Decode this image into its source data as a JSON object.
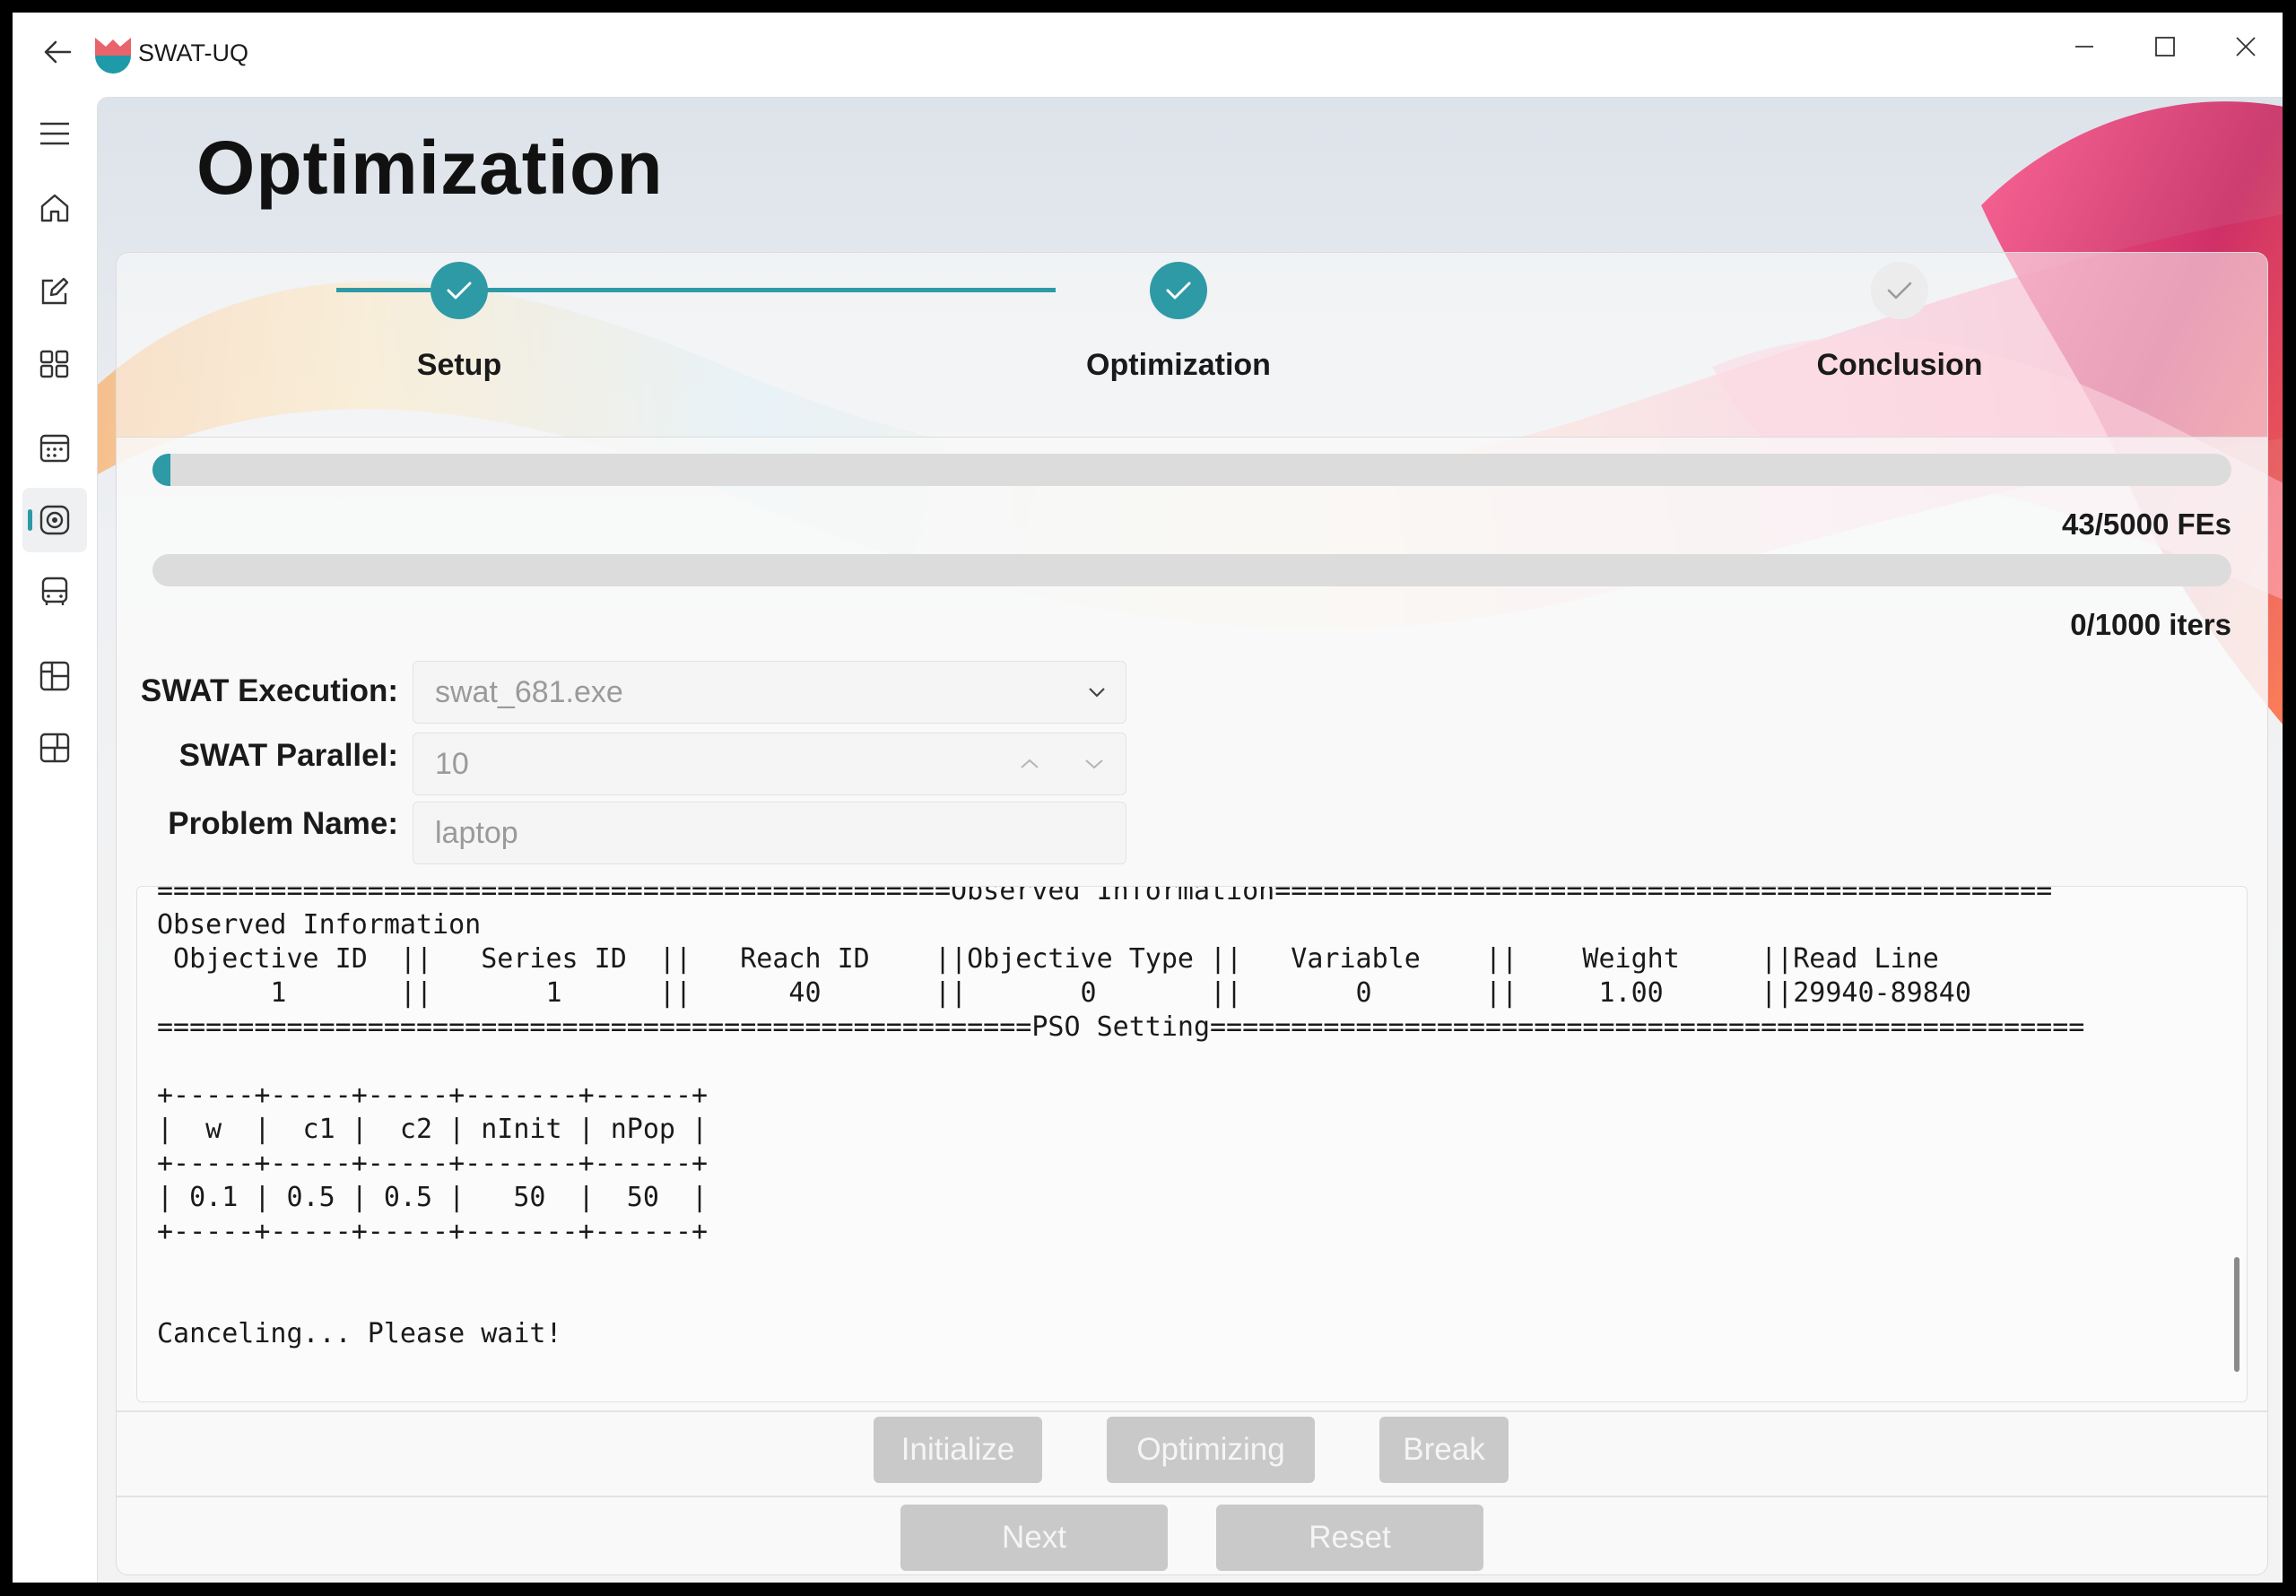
{
  "app": {
    "title": "SWAT-UQ",
    "accent": "#2e9aa6"
  },
  "titlebar_icons": {
    "back": "back-arrow-icon",
    "minimize": "minimize-icon",
    "maximize": "maximize-icon",
    "close": "close-icon"
  },
  "sidebar": {
    "items": [
      {
        "icon": "hamburger-menu-icon"
      },
      {
        "icon": "home-icon"
      },
      {
        "icon": "edit-icon"
      },
      {
        "icon": "apps-icon"
      },
      {
        "icon": "calendar-icon"
      },
      {
        "icon": "target-icon",
        "active": true
      },
      {
        "icon": "bus-icon"
      },
      {
        "icon": "layout-icon"
      },
      {
        "icon": "layout-alt-icon"
      }
    ]
  },
  "page": {
    "title": "Optimization"
  },
  "stepper": {
    "steps": [
      {
        "label": "Setup",
        "state": "done"
      },
      {
        "label": "Optimization",
        "state": "done"
      },
      {
        "label": "Conclusion",
        "state": "pending"
      }
    ]
  },
  "progress": {
    "fes": {
      "text": "43/5000 FEs",
      "fraction": 0.0086
    },
    "iters": {
      "text": "0/1000 iters",
      "fraction": 0.0
    }
  },
  "form": {
    "execution_label": "SWAT Execution:",
    "execution_value": "swat_681.exe",
    "parallel_label": "SWAT Parallel:",
    "parallel_value": "10",
    "problem_label": "Problem Name:",
    "problem_value": "laptop"
  },
  "console": {
    "lines": [
      "=================================================Observed Information================================================",
      "Observed Information",
      " Objective ID  ||   Series ID  ||   Reach ID    ||Objective Type ||   Variable    ||    Weight     ||Read Line",
      "       1       ||       1      ||      40       ||       0       ||       0       ||     1.00      ||29940-89840",
      "======================================================PSO Setting======================================================",
      "",
      "+-----+-----+-----+-------+------+",
      "|  w  |  c1 |  c2 | nInit | nPop |",
      "+-----+-----+-----+-------+------+",
      "| 0.1 | 0.5 | 0.5 |   50  |  50  |",
      "+-----+-----+-----+-------+------+",
      "",
      "",
      "Canceling... Please wait!"
    ]
  },
  "buttons": {
    "initialize": "Initialize",
    "optimizing": "Optimizing",
    "break": "Break",
    "next": "Next",
    "reset": "Reset"
  }
}
